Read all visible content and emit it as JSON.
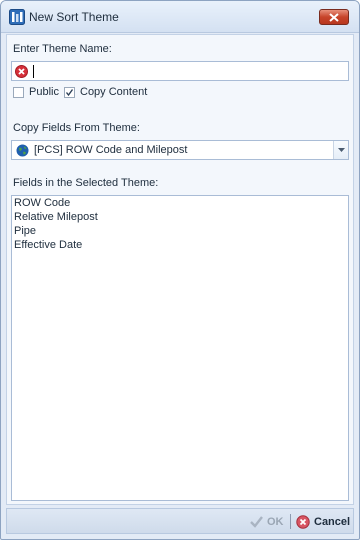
{
  "window": {
    "title": "New Sort Theme",
    "close_icon": "close-x-icon"
  },
  "form": {
    "theme_name_label": "Enter Theme Name:",
    "theme_name_value": "",
    "public_label": "Public",
    "public_checked": false,
    "copy_content_label": "Copy Content",
    "copy_content_checked": true,
    "copy_fields_label": "Copy Fields From Theme:",
    "copy_fields_selected": "[PCS] ROW Code and Milepost",
    "fields_label": "Fields in the Selected Theme:",
    "fields": [
      "ROW Code",
      "Relative Milepost",
      "Pipe",
      "Effective Date"
    ]
  },
  "footer": {
    "ok_label": "OK",
    "ok_enabled": false,
    "cancel_label": "Cancel"
  },
  "colors": {
    "error": "#d6303a",
    "accent": "#1f5fae"
  }
}
